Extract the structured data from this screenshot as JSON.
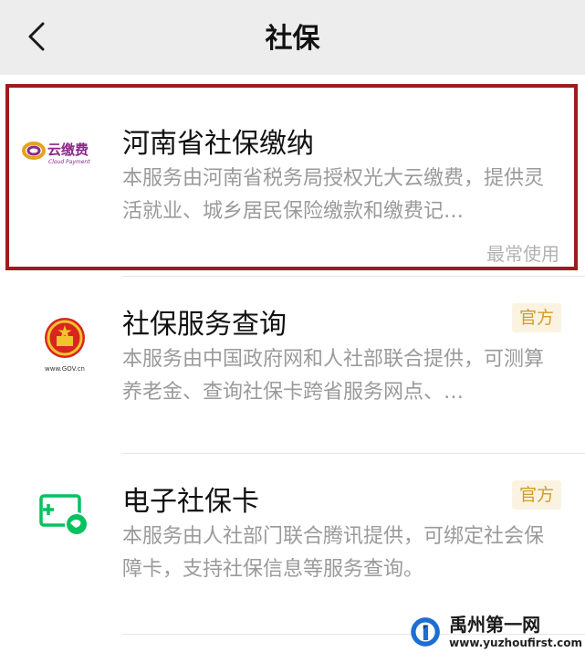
{
  "nav": {
    "title": "社保",
    "back_icon": "chevron-left-icon"
  },
  "items": [
    {
      "name": "河南省社保缴纳",
      "logo_text": "云缴费",
      "logo_subtext": "Cloud Payment",
      "description": "本服务由河南省税务局授权光大云缴费，提供灵活就业、城乡居民保险缴款和缴费记…",
      "hint": "最常使用",
      "highlighted": true
    },
    {
      "name": "社保服务查询",
      "logo_subtext": "www.GOV.cn",
      "badge": "官方",
      "description": "本服务由中国政府网和人社部联合提供，可测算养老金、查询社保卡跨省服务网点、…"
    },
    {
      "name": "电子社保卡",
      "badge": "官方",
      "description": "本服务由人社部门联合腾讯提供，可绑定社会保障卡，支持社保信息等服务查询。"
    }
  ],
  "watermark": {
    "title": "禹州第一网",
    "url": "www.yuzhoufirst.com"
  },
  "colors": {
    "nav_bg": "#ededed",
    "highlight_border": "#9e1b1b",
    "badge_bg": "#fbf3e1",
    "badge_text": "#d69a2a",
    "wechat_green": "#07c160"
  }
}
